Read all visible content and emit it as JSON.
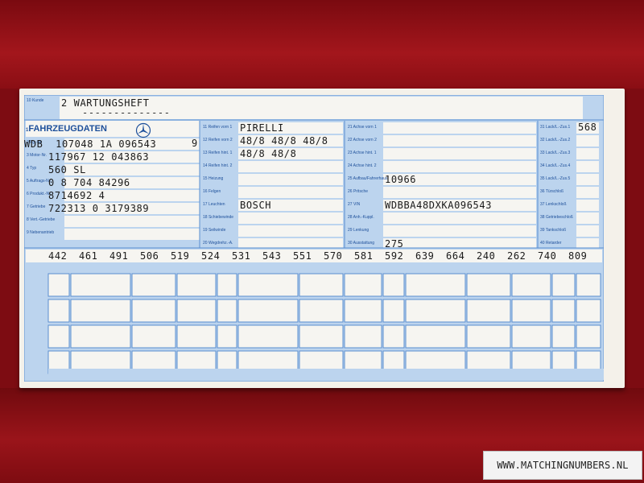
{
  "header": {
    "label_10": "10 Kunde",
    "wartungsheft": "2 WARTUNGSHEFT",
    "dashes": "--------------",
    "right_value": "568"
  },
  "section": {
    "title": "FAHRZEUGDATEN",
    "prefix": "1"
  },
  "left_labels": [
    "2 Fg.-Nr.",
    "3 Motor-Nr.",
    "4 Typ",
    "5 Auftrags-Nr.",
    "6 Produkt.-Nr.",
    "7 Getriebe",
    "8 Vert.-Getriebe",
    "9 Nebenantrieb"
  ],
  "left_values": [
    "WDB  107048 1A 096543",
    "117967 12 043863",
    "560 SL",
    "0 8 704 84296",
    "8714692 4",
    "722313 0 3179389",
    "",
    ""
  ],
  "vin_check": "9",
  "col2_labels": [
    "11 Reifen vorn 1",
    "12 Reifen vorn 2",
    "13 Reifen hint. 1",
    "14 Reifen hint. 2",
    "15 Heizung",
    "16 Felgen",
    "17 Leuchten",
    "18 Schiebewinde",
    "19 Seilwinde",
    "20 Wegdrehz.-A."
  ],
  "col2_values": [
    "PIRELLI",
    "48/8 48/8 48/8",
    "48/8 48/8",
    "",
    "",
    "",
    "BOSCH",
    "",
    "",
    ""
  ],
  "col3_labels": [
    "21 Achse vorn 1",
    "22 Achse vorn 2",
    "23 Achse hint. 1",
    "24 Achse hint. 2",
    "25 Aufbau/Fahrerhaus",
    "26 Pritsche",
    "27 VIN",
    "28 Anh.-Kuppl.",
    "29 Lenkung",
    "30 Ausstattung"
  ],
  "col3_values": [
    "",
    "",
    "",
    "",
    "10966",
    "",
    "WDBBA48DXKA096543",
    "",
    "",
    "275"
  ],
  "col4_labels": [
    "31 Lack/L.-Zus.1",
    "32 Lack/L.-Zus.2",
    "33 Lack/L.-Zus.3",
    "34 Lack/L.-Zus.4",
    "35 Lack/L.-Zus.5",
    "36 Türschloß",
    "37 Lenkschloß",
    "38 Getriebeschloß",
    "39 Tankschloß",
    "40 Retarder"
  ],
  "codes": [
    "442",
    "461",
    "491",
    "506",
    "519",
    "524",
    "531",
    "543",
    "551",
    "570",
    "581",
    "592",
    "639",
    "664",
    "240",
    "262",
    "740",
    "809"
  ],
  "watermark": "WWW.MATCHINGNUMBERS.NL",
  "colors": {
    "ink_blue": "#1d4f9a",
    "form_blue": "#b9d2ec",
    "grid_blue": "#5a8ed0",
    "paper": "#f4f1ea",
    "background_red": "#8e0d12"
  }
}
